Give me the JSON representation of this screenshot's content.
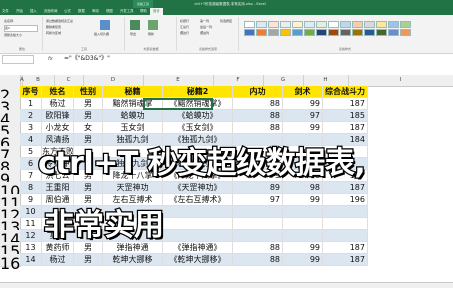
{
  "window": {
    "title": "ctrl+T秒变超级数据表,非常实用.xlsx - Excel",
    "context_tab": "表格工具"
  },
  "ribbon": {
    "tabs": [
      "文件",
      "开始",
      "插入",
      "页面布局",
      "公式",
      "数据",
      "审阅",
      "视图",
      "开发工具",
      "帮助",
      "设计"
    ],
    "active_tab": "设计",
    "groups": {
      "properties": {
        "label": "属性",
        "table_name_label": "表名称:",
        "table_name": "表1",
        "resize": "调整表格大小"
      },
      "tools": {
        "label": "工具",
        "items": [
          "通过数据透视表汇总",
          "删除重复值",
          "转换为区域"
        ],
        "slicer": "插入切片器"
      },
      "external": {
        "label": "外部表数据",
        "export": "导出",
        "refresh": "刷新"
      },
      "style_options": {
        "label": "表格样式选项",
        "items": [
          "标题行",
          "汇总行",
          "镶边行",
          "第一列",
          "最后一列",
          "镶边列",
          "筛选按钮"
        ]
      },
      "styles": {
        "label": "表格样式"
      }
    }
  },
  "formula_bar": {
    "name_box": "",
    "fx": "fx",
    "formula": "=\"《\"&D3&\"》\""
  },
  "columns": [
    "A",
    "B",
    "C",
    "D",
    "E",
    "F",
    "G",
    "H",
    "I"
  ],
  "table": {
    "headers": [
      "序号",
      "姓名",
      "性别",
      "秘籍",
      "秘籍2",
      "内功",
      "剑术",
      "综合战斗力"
    ],
    "rows": [
      {
        "id": "1",
        "name": "杨过",
        "sex": "男",
        "book": "黯然销魂掌",
        "book2": "《黯然销魂掌》",
        "inner": "88",
        "sword": "99",
        "power": "187"
      },
      {
        "id": "2",
        "name": "欧阳锋",
        "sex": "男",
        "book": "蛤蟆功",
        "book2": "《蛤蟆功》",
        "inner": "88",
        "sword": "97",
        "power": "185"
      },
      {
        "id": "3",
        "name": "小龙女",
        "sex": "女",
        "book": "玉女剑",
        "book2": "《玉女剑》",
        "inner": "88",
        "sword": "99",
        "power": "187"
      },
      {
        "id": "4",
        "name": "风清扬",
        "sex": "男",
        "book": "独孤九剑",
        "book2": "《独孤九剑》",
        "inner": "",
        "sword": "",
        "power": "184"
      },
      {
        "id": "5",
        "name": "东方不败",
        "sex": "",
        "book": "",
        "book2": "",
        "inner": "",
        "sword": "",
        "power": ""
      },
      {
        "id": "6",
        "name": "令狐冲",
        "sex": "男",
        "book": "独孤九剑",
        "book2": "《独孤九剑》",
        "inner": "",
        "sword": "",
        "power": ""
      },
      {
        "id": "7",
        "name": "洪七公",
        "sex": "男",
        "book": "降龙十八掌",
        "book2": "《降龙十八掌》",
        "inner": "79",
        "sword": "78",
        "power": "157"
      },
      {
        "id": "8",
        "name": "王重阳",
        "sex": "男",
        "book": "天罡神功",
        "book2": "《天罡神功》",
        "inner": "89",
        "sword": "98",
        "power": "187"
      },
      {
        "id": "9",
        "name": "周伯通",
        "sex": "男",
        "book": "左右互搏术",
        "book2": "《左右互搏术》",
        "inner": "97",
        "sword": "99",
        "power": "196"
      },
      {
        "id": "10",
        "name": "",
        "sex": "",
        "book": "",
        "book2": "",
        "inner": "",
        "sword": "",
        "power": ""
      },
      {
        "id": "11",
        "name": "",
        "sex": "",
        "book": "",
        "book2": "",
        "inner": "",
        "sword": "",
        "power": ""
      },
      {
        "id": "12",
        "name": "莫愁",
        "sex": "",
        "book": "",
        "book2": "",
        "inner": "",
        "sword": "",
        "power": ""
      },
      {
        "id": "13",
        "name": "黄药师",
        "sex": "男",
        "book": "弹指神通",
        "book2": "《弹指神通》",
        "inner": "88",
        "sword": "99",
        "power": "187"
      },
      {
        "id": "14",
        "name": "杨过",
        "sex": "男",
        "book": "乾坤大挪移",
        "book2": "《乾坤大挪移》",
        "inner": "88",
        "sword": "99",
        "power": "187"
      }
    ],
    "row_numbers": [
      "2",
      "3",
      "4",
      "5",
      "6",
      "7",
      "8",
      "9",
      "10",
      "11",
      "12",
      "13",
      "14",
      "15",
      "16",
      "17"
    ]
  },
  "overlay": {
    "line1": "ctrl+T 秒变超级数据表,",
    "line2": "非常实用"
  },
  "colors": {
    "excel_green": "#217346",
    "header_fill": "#ffe500",
    "band_fill": "#dce6f1"
  }
}
